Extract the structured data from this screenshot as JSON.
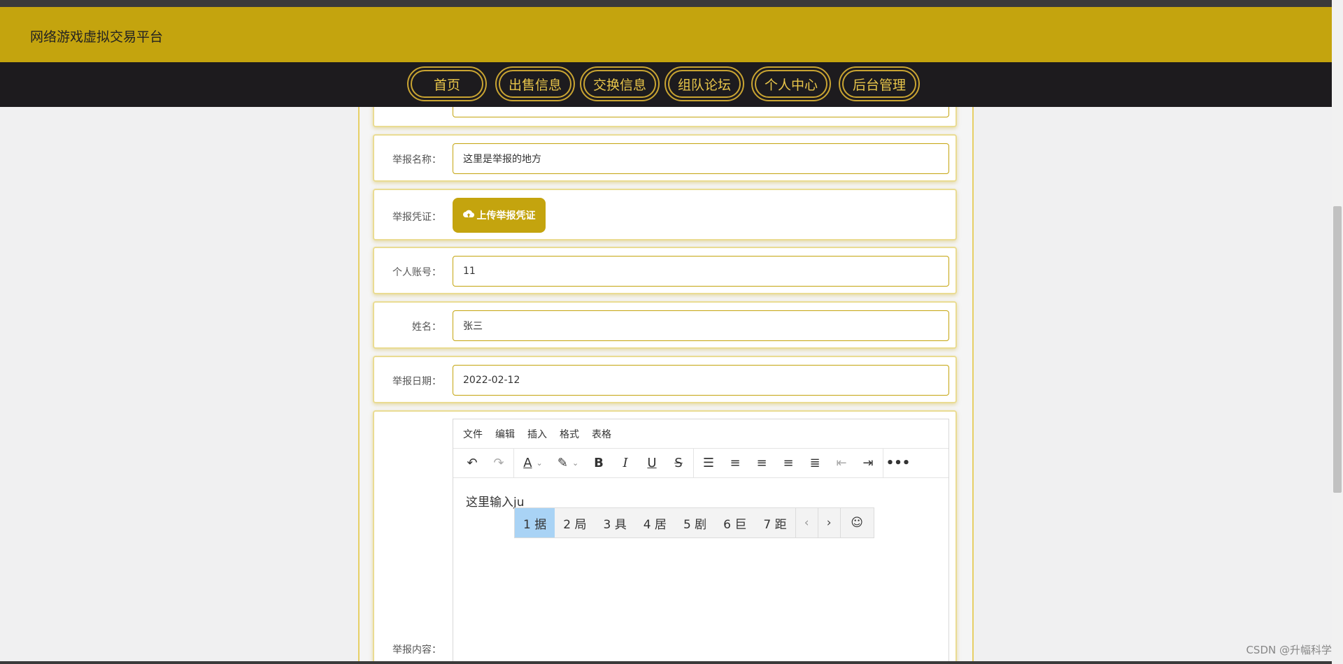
{
  "header": {
    "site_title": "网络游戏虚拟交易平台"
  },
  "nav": {
    "items": [
      "首页",
      "出售信息",
      "交换信息",
      "组队论坛",
      "个人中心",
      "后台管理"
    ]
  },
  "form": {
    "report_name": {
      "label": "举报名称：",
      "value": "这里是举报的地方"
    },
    "report_proof": {
      "label": "举报凭证：",
      "button": "上传举报凭证"
    },
    "account": {
      "label": "个人账号：",
      "value": "11"
    },
    "name": {
      "label": "姓名：",
      "value": "张三"
    },
    "report_date": {
      "label": "举报日期：",
      "value": "2022-02-12"
    },
    "report_content": {
      "label": "举报内容："
    }
  },
  "editor": {
    "menus": [
      "文件",
      "编辑",
      "插入",
      "格式",
      "表格"
    ],
    "content": "这里输入ju",
    "ime_candidates": [
      "1 据",
      "2 局",
      "3 具",
      "4 居",
      "5 剧",
      "6 巨",
      "7 距"
    ]
  },
  "watermark": "CSDN @升幅科学"
}
